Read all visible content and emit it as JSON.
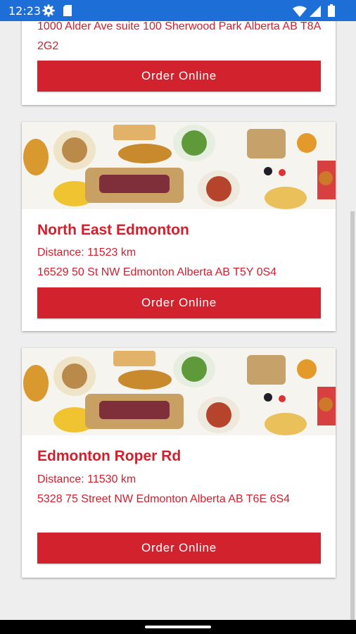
{
  "status_bar": {
    "time": "12:23",
    "icons": [
      "gear-icon",
      "sd-card-icon",
      "wifi-icon",
      "signal-icon",
      "battery-icon"
    ],
    "background": "#1e6ed8"
  },
  "colors": {
    "accent": "#d2222d",
    "text_red": "#d0202e",
    "page_bg": "#eeeeee"
  },
  "locations": [
    {
      "address": "1000 Alder Ave suite 100 Sherwood Park Alberta AB T8A 2G2",
      "button_label": "Order Online"
    },
    {
      "name": "North East Edmonton",
      "distance": "Distance: 11523 km",
      "address": "16529 50 St NW Edmonton Alberta AB T5Y 0S4",
      "button_label": "Order Online"
    },
    {
      "name": "Edmonton Roper Rd",
      "distance": "Distance: 11530 km",
      "address": "5328 75 Street NW Edmonton Alberta AB T6E 6S4",
      "button_label": "Order Online"
    }
  ]
}
